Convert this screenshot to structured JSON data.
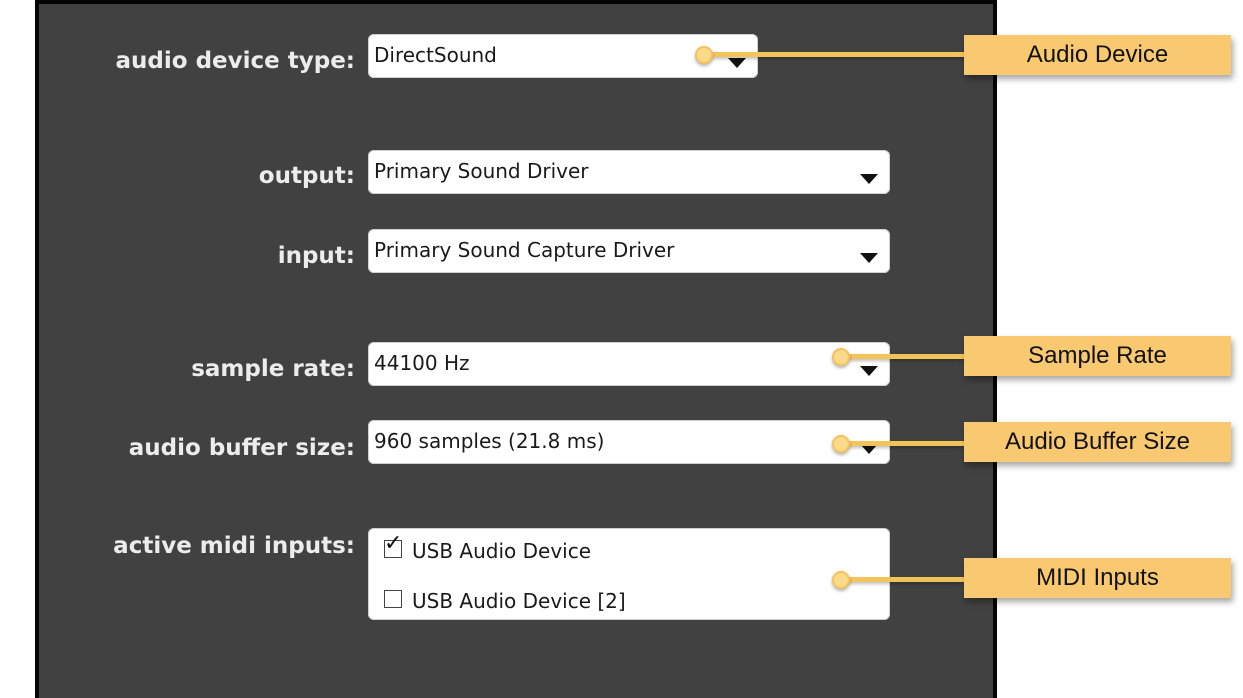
{
  "audio_device_type": {
    "label": "audio device type:",
    "value": "DirectSound"
  },
  "output": {
    "label": "output:",
    "value": "Primary Sound Driver"
  },
  "input": {
    "label": "input:",
    "value": "Primary Sound Capture Driver"
  },
  "sample_rate": {
    "label": "sample rate:",
    "value": "44100 Hz"
  },
  "audio_buffer_size": {
    "label": "audio buffer size:",
    "value": "960 samples (21.8 ms)"
  },
  "midi_inputs": {
    "label": "active midi inputs:",
    "items": [
      {
        "label": "USB Audio Device",
        "checked": true
      },
      {
        "label": "USB Audio Device [2]",
        "checked": false
      }
    ]
  },
  "icons": {
    "dropdown": "chevron-down-icon",
    "checked_mark": "✓"
  },
  "callouts": [
    {
      "label": "Audio Device"
    },
    {
      "label": "Sample Rate"
    },
    {
      "label": "Audio Buffer Size"
    },
    {
      "label": "MIDI Inputs"
    }
  ],
  "colors": {
    "panel_bg": "#414141",
    "callout_bg": "#f8c970",
    "callout_line": "#f6c25a"
  }
}
